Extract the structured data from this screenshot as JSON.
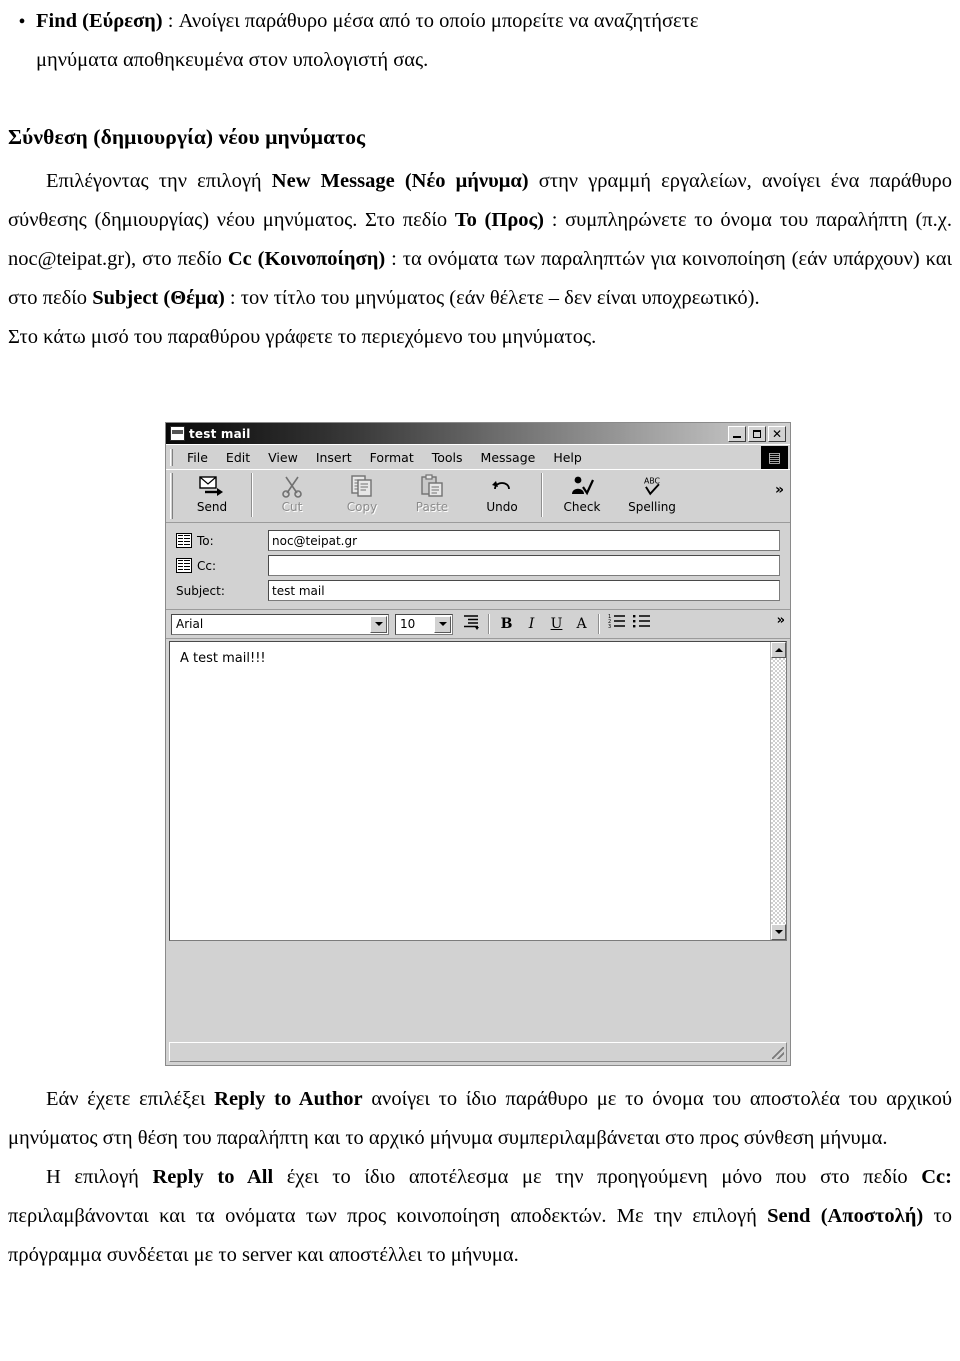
{
  "document": {
    "bullet_find": {
      "marker": "•",
      "line1_bold": "Find (Εύρεση)",
      "line1_rest": " : Ανοίγει παράθυρο μέσα από το οποίο μπορείτε να αναζητήσετε",
      "line2": "μηνύματα αποθηκευμένα στον υπολογιστή σας."
    },
    "heading": "Σύνθεση (δημιουργία) νέου μηνύματος",
    "para1": {
      "t1": "Επιλέγοντας την επιλογή ",
      "b1": "New Message (Νέο μήνυμα)",
      "t2": " στην γραμμή εργαλείων, ανοίγει ένα παράθυρο σύνθεσης (δημιουργίας) νέου μηνύματος. Στο πεδίο ",
      "b2": "To (Προς)",
      "t3": " : συμπληρώνετε το όνομα του παραλήπτη (π.χ. noc@teipat.gr), στο πεδίο ",
      "b3": "Cc (Κοινοποίηση)",
      "t4": " : τα ονόματα των παραληπτών για κοινοποίηση (εάν υπάρχουν) και στο πεδίο ",
      "b4": "Subject (Θέμα)",
      "t5": " : τον τίτλο του μηνύματος (εάν θέλετε – δεν είναι υποχρεωτικό)."
    },
    "para2": "Στο κάτω μισό του παραθύρου γράφετε το περιεχόμενο του μηνύματος.",
    "para3": {
      "t1": "Εάν έχετε επιλέξει ",
      "b1": "Reply to Author",
      "t2": " ανοίγει το ίδιο παράθυρο με το όνομα του αποστολέα του αρχικού μηνύματος στη θέση του παραλήπτη και το αρχικό μήνυμα συμπεριλαμβάνεται στο προς σύνθεση μήνυμα."
    },
    "para4": {
      "t1": "Η επιλογή ",
      "b1": "Reply to All",
      "t2": " έχει το ίδιο αποτέλεσμα με την προηγούμενη μόνο που στο πεδίο ",
      "b2": "Cc:",
      "t3": " περιλαμβάνονται και τα ονόματα των προς κοινοποίηση αποδεκτών. Με την επιλογή ",
      "b3": "Send (Αποστολή)",
      "t4": " το πρόγραμμα συνδέεται με το server και αποστέλλει το μήνυμα."
    }
  },
  "mail_window": {
    "title": "test mail",
    "window_buttons": {
      "minimize": "–",
      "maximize": "□",
      "close": "✕"
    },
    "menu": [
      "File",
      "Edit",
      "View",
      "Insert",
      "Format",
      "Tools",
      "Message",
      "Help"
    ],
    "logo_glyph": "▤",
    "toolbar": [
      {
        "label": "Send",
        "icon": "send-icon",
        "enabled": true
      },
      {
        "label": "Cut",
        "icon": "scissors-icon",
        "enabled": false
      },
      {
        "label": "Copy",
        "icon": "copy-icon",
        "enabled": false
      },
      {
        "label": "Paste",
        "icon": "paste-icon",
        "enabled": false
      },
      {
        "label": "Undo",
        "icon": "undo-icon",
        "enabled": true
      },
      {
        "label": "Check",
        "icon": "check-names-icon",
        "enabled": true
      },
      {
        "label": "Spelling",
        "icon": "spelling-abc-icon",
        "enabled": true
      }
    ],
    "toolbar_overflow": "»",
    "headers": [
      {
        "label": "To:",
        "value": "noc@teipat.gr",
        "has_book_icon": true
      },
      {
        "label": "Cc:",
        "value": "",
        "has_book_icon": true
      },
      {
        "label": "Subject:",
        "value": "test mail",
        "has_book_icon": false
      }
    ],
    "format_bar": {
      "font_family": "Arial",
      "font_size": "10",
      "paragraph_style_icon": "paragraph-style-icon",
      "bold": "B",
      "italic": "I",
      "underline": "U",
      "font_color": "A",
      "numbered_list_icon": "numbered-list-icon",
      "bulleted_list_icon": "bulleted-list-icon",
      "overflow": "»"
    },
    "body_text": "A test mail!!!",
    "scrollbar": {
      "up": "▲",
      "down": "▼"
    }
  },
  "colors": {
    "window_face": "#d4d0c8",
    "titlebar_start": "#0a0a0a",
    "titlebar_end": "#cfcfcf",
    "field_bg": "#ffffff",
    "disabled_text": "#8b8b8b",
    "page_bg": "#ffffff",
    "text": "#000000"
  }
}
